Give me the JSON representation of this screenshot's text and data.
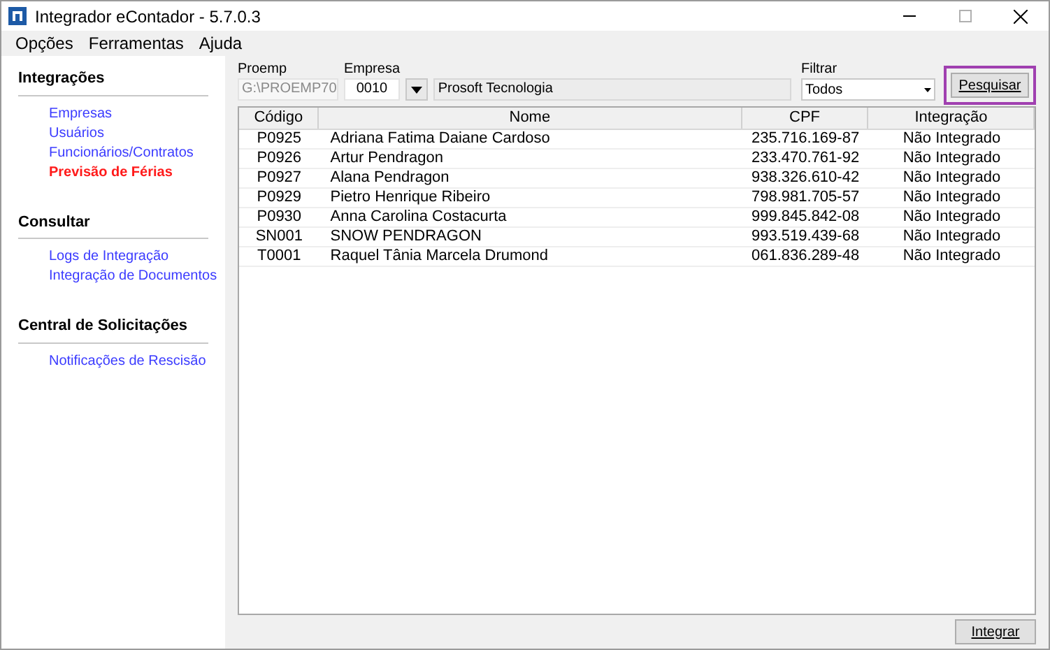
{
  "window": {
    "title": "Integrador eContador - 5.7.0.3"
  },
  "menu": [
    "Opções",
    "Ferramentas",
    "Ajuda"
  ],
  "sidebar": [
    {
      "heading": "Integrações",
      "items": [
        {
          "label": "Empresas",
          "selected": false
        },
        {
          "label": "Usuários",
          "selected": false
        },
        {
          "label": "Funcionários/Contratos",
          "selected": false
        },
        {
          "label": "Previsão de Férias",
          "selected": true
        }
      ]
    },
    {
      "heading": "Consultar",
      "items": [
        {
          "label": "Logs de Integração",
          "selected": false
        },
        {
          "label": "Integração de Documentos",
          "selected": false
        }
      ]
    },
    {
      "heading": "Central de Solicitações",
      "items": [
        {
          "label": "Notificações de Rescisão",
          "selected": false
        }
      ]
    }
  ],
  "filters": {
    "proemp": {
      "label": "Proemp",
      "value": "G:\\PROEMP70",
      "disabled": true
    },
    "empresa": {
      "label": "Empresa",
      "code": "0010",
      "name": "Prosoft Tecnologia"
    },
    "filtrar": {
      "label": "Filtrar",
      "value": "Todos"
    },
    "search_button": {
      "label": "Pesquisar",
      "highlighted": true
    }
  },
  "table": {
    "columns": [
      "Código",
      "Nome",
      "CPF",
      "Integração"
    ],
    "rows": [
      [
        "P0925",
        "Adriana Fatima Daiane Cardoso",
        "235.716.169-87",
        "Não Integrado"
      ],
      [
        "P0926",
        "Artur Pendragon",
        "233.470.761-92",
        "Não Integrado"
      ],
      [
        "P0927",
        "Alana Pendragon",
        "938.326.610-42",
        "Não Integrado"
      ],
      [
        "P0929",
        "Pietro Henrique Ribeiro",
        "798.981.705-57",
        "Não Integrado"
      ],
      [
        "P0930",
        "Anna Carolina Costacurta",
        "999.845.842-08",
        "Não Integrado"
      ],
      [
        "SN001",
        "SNOW PENDRAGON",
        "993.519.439-68",
        "Não Integrado"
      ],
      [
        "T0001",
        "Raquel Tânia Marcela Drumond",
        "061.836.289-48",
        "Não Integrado"
      ]
    ]
  },
  "footer_button": "Integrar"
}
